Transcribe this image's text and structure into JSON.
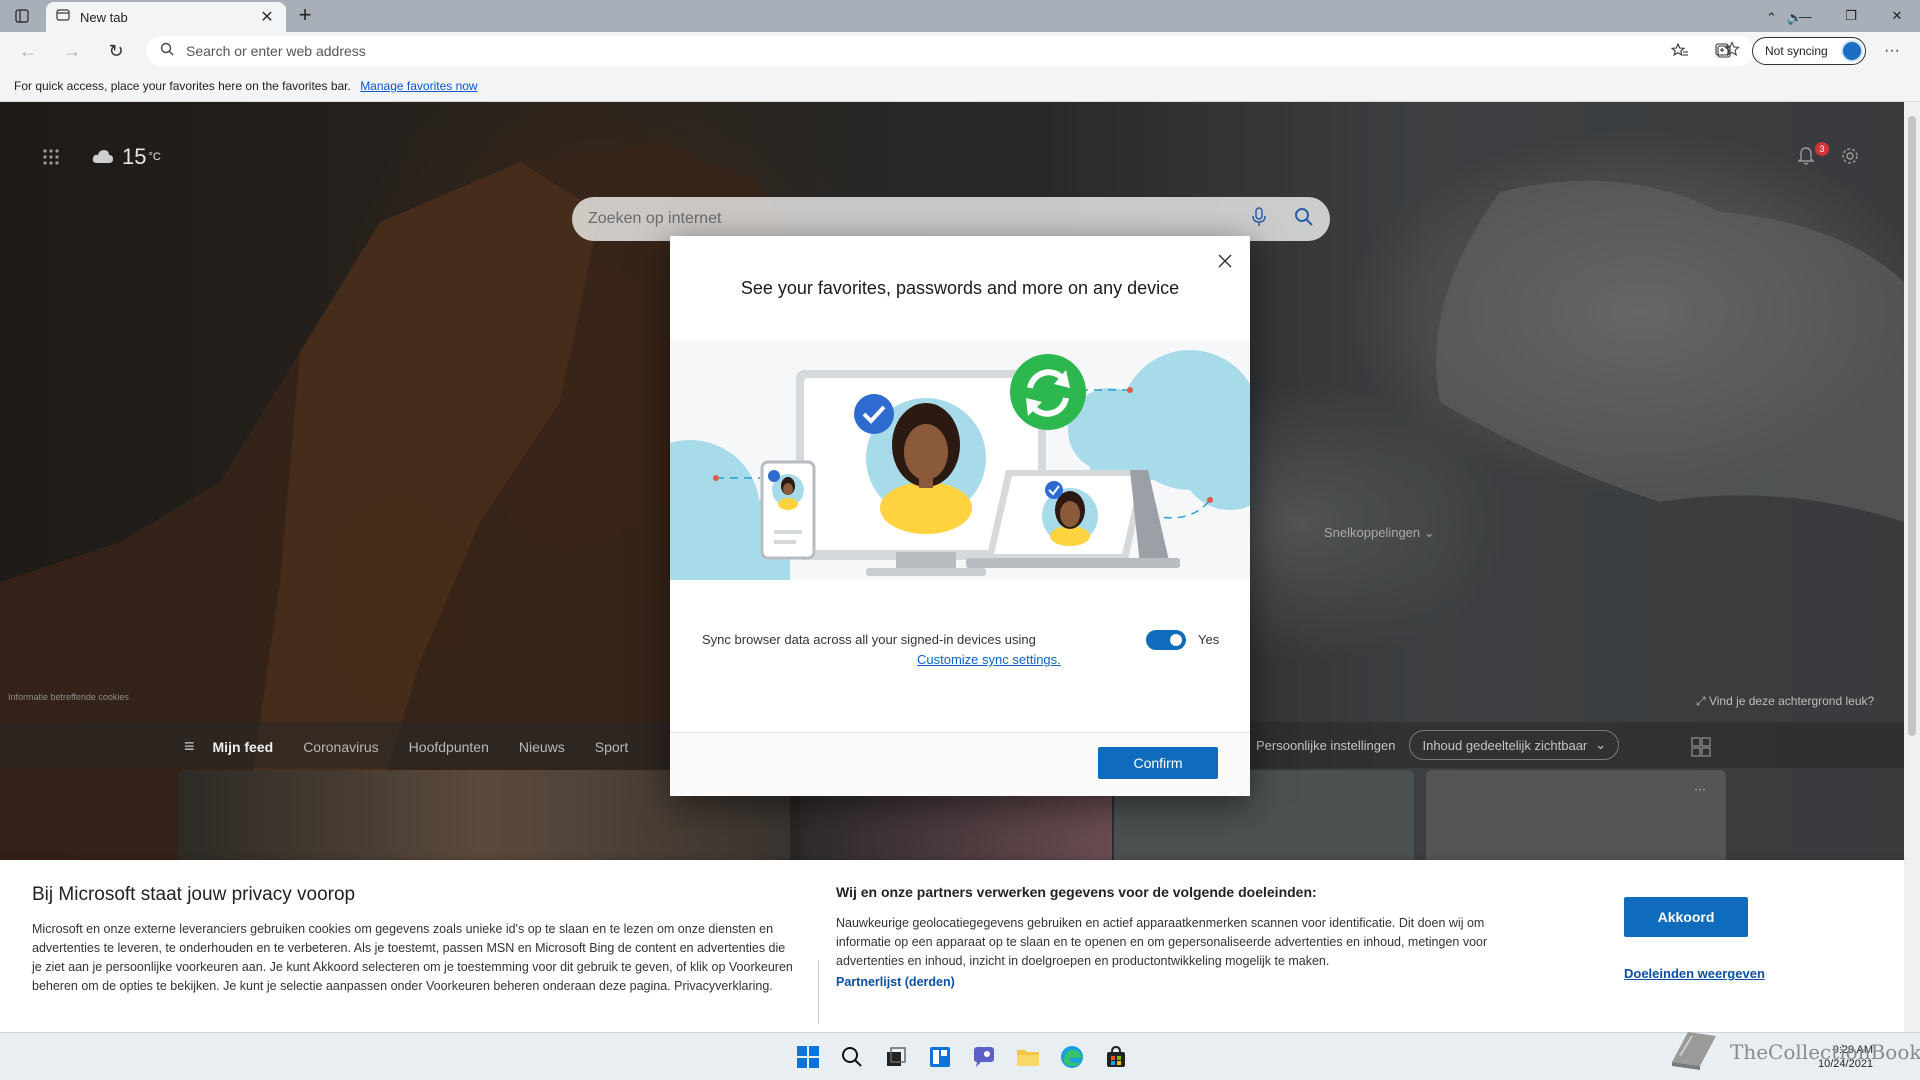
{
  "browser": {
    "tab_title": "New tab",
    "address_placeholder": "Search or enter web address",
    "sync_status": "Not syncing",
    "favorites_bar_text": "For quick access, place your favorites here on the favorites bar.",
    "favorites_link": "Manage favorites now"
  },
  "newtab": {
    "weather_temp": "15",
    "weather_unit": "°C",
    "notification_count": "3",
    "search_placeholder": "Zoeken op internet",
    "quicklinks_label": "Snelkoppelingen",
    "background_question": "Vind je deze achtergrond leuk?",
    "cookie_info": "Informatie betreffende cookies",
    "feed_tabs": [
      {
        "label": "Mijn feed"
      },
      {
        "label": "Coronavirus"
      },
      {
        "label": "Hoofdpunten"
      },
      {
        "label": "Nieuws"
      },
      {
        "label": "Sport"
      }
    ],
    "personal_settings": "Persoonlijke instellingen",
    "content_visibility": "Inhoud gedeeltelijk zichtbaar"
  },
  "modal": {
    "title": "See your favorites, passwords and more on any device",
    "sync_text": "Sync browser data across all your signed-in devices using",
    "sync_link": "Customize sync settings.",
    "toggle_label": "Yes",
    "confirm_label": "Confirm"
  },
  "consent": {
    "title": "Bij Microsoft staat jouw privacy voorop",
    "body": "Microsoft en onze externe leveranciers gebruiken cookies om gegevens zoals unieke id's op te slaan en te lezen om onze diensten en advertenties te leveren, te onderhouden en te verbeteren. Als je toestemt, passen MSN en Microsoft Bing de content en advertenties die je ziet aan je persoonlijke voorkeuren aan. Je kunt Akkoord selecteren om je toestemming voor dit gebruik te geven, of klik op Voorkeuren beheren om de opties te bekijken. Je kunt je selectie aanpassen onder Voorkeuren beheren onderaan deze pagina. Privacyverklaring.",
    "purposes_title": "Wij en onze partners verwerken gegevens voor de volgende doeleinden:",
    "purposes_body": "Nauwkeurige geolocatiegegevens gebruiken en actief apparaatkenmerken scannen voor identificatie. Dit doen wij om informatie op een apparaat op te slaan en te openen en om gepersonaliseerde advertenties en inhoud, metingen voor advertenties en inhoud, inzicht in doelgroepen en productontwikkeling mogelijk te maken.",
    "partner_link": "Partnerlijst (derden)",
    "accept_label": "Akkoord",
    "purposes_link": "Doeleinden weergeven"
  },
  "taskbar": {
    "time": "9:29 AM",
    "date": "10/24/2021",
    "watermark": "TheCollectionBook"
  },
  "colors": {
    "accent": "#0f6cbd",
    "link": "#0b62c4",
    "sync_green": "#2db84f"
  }
}
